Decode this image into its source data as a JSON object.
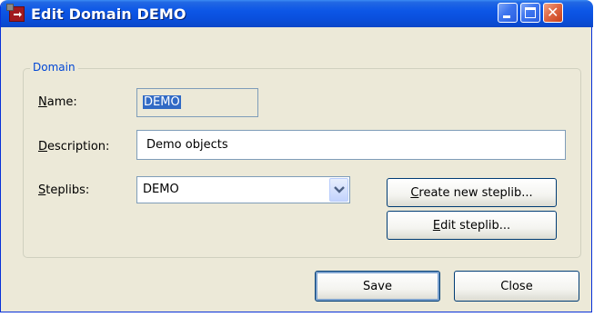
{
  "window": {
    "title": "Edit Domain DEMO",
    "icons": {
      "app": "app-icon",
      "minimize": "minimize-icon",
      "maximize": "maximize-icon",
      "close": "close-icon"
    }
  },
  "group": {
    "legend": "Domain"
  },
  "form": {
    "name": {
      "label_access": "N",
      "label_rest": "ame:",
      "value": "DEMO"
    },
    "description": {
      "label_access": "D",
      "label_rest": "escription:",
      "value": "Demo objects"
    },
    "steplibs": {
      "label_access": "S",
      "label_rest": "teplibs:",
      "selected": "DEMO"
    }
  },
  "buttons": {
    "create_steplib": {
      "access": "C",
      "rest": "reate new steplib..."
    },
    "edit_steplib": {
      "access": "E",
      "rest": "dit steplib..."
    },
    "save": "Save",
    "close": "Close"
  },
  "colors": {
    "title_bar": "#0a4fdc",
    "window_face": "#ece9d8",
    "group_legend": "#0046d5",
    "selection": "#316ac5",
    "close_button": "#e06a45"
  }
}
